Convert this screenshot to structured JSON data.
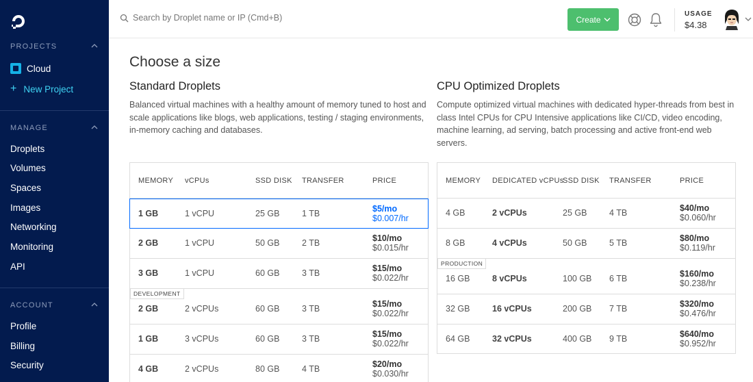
{
  "sidebar": {
    "projects_header": "PROJECTS",
    "projects": [
      {
        "label": "Cloud"
      },
      {
        "label": "New Project"
      }
    ],
    "manage_header": "MANAGE",
    "manage_items": [
      {
        "label": "Droplets"
      },
      {
        "label": "Volumes"
      },
      {
        "label": "Spaces"
      },
      {
        "label": "Images"
      },
      {
        "label": "Networking"
      },
      {
        "label": "Monitoring"
      },
      {
        "label": "API"
      }
    ],
    "account_header": "ACCOUNT",
    "account_items": [
      {
        "label": "Profile"
      },
      {
        "label": "Billing"
      },
      {
        "label": "Security"
      }
    ]
  },
  "topbar": {
    "search_placeholder": "Search by Droplet name or IP (Cmd+B)",
    "create_label": "Create",
    "usage_label": "USAGE",
    "usage_value": "$4.38"
  },
  "main": {
    "title": "Choose a size",
    "standard": {
      "title": "Standard Droplets",
      "description": "Balanced virtual machines with a healthy amount of memory tuned to host and scale applications like blogs, web applications, testing / staging environments, in-memory caching and databases.",
      "headers": [
        "MEMORY",
        "vCPUs",
        "SSD DISK",
        "TRANSFER",
        "PRICE"
      ],
      "rows": [
        {
          "memory": "1 GB",
          "vcpus": "1 vCPU",
          "disk": "25 GB",
          "transfer": "1 TB",
          "price_mo": "$5/mo",
          "price_hr": "$0.007/hr",
          "selected": true,
          "tag": ""
        },
        {
          "memory": "2 GB",
          "vcpus": "1 vCPU",
          "disk": "50 GB",
          "transfer": "2 TB",
          "price_mo": "$10/mo",
          "price_hr": "$0.015/hr",
          "tag": ""
        },
        {
          "memory": "3 GB",
          "vcpus": "1 vCPU",
          "disk": "60 GB",
          "transfer": "3 TB",
          "price_mo": "$15/mo",
          "price_hr": "$0.022/hr",
          "tag": ""
        },
        {
          "memory": "2 GB",
          "vcpus": "2 vCPUs",
          "disk": "60 GB",
          "transfer": "3 TB",
          "price_mo": "$15/mo",
          "price_hr": "$0.022/hr",
          "tag": "DEVELOPMENT"
        },
        {
          "memory": "1 GB",
          "vcpus": "3 vCPUs",
          "disk": "60 GB",
          "transfer": "3 TB",
          "price_mo": "$15/mo",
          "price_hr": "$0.022/hr",
          "tag": ""
        },
        {
          "memory": "4 GB",
          "vcpus": "2 vCPUs",
          "disk": "80 GB",
          "transfer": "4 TB",
          "price_mo": "$20/mo",
          "price_hr": "$0.030/hr",
          "tag": ""
        }
      ]
    },
    "cpu": {
      "title": "CPU Optimized Droplets",
      "description": "Compute optimized virtual machines with dedicated hyper-threads from best in class Intel CPUs for CPU Intensive applications like CI/CD, video encoding, machine learning, ad serving, batch processing and active front-end web servers.",
      "headers": [
        "MEMORY",
        "DEDICATED vCPUs",
        "SSD DISK",
        "TRANSFER",
        "PRICE"
      ],
      "rows": [
        {
          "memory": "4 GB",
          "vcpus": "2 vCPUs",
          "disk": "25 GB",
          "transfer": "4 TB",
          "price_mo": "$40/mo",
          "price_hr": "$0.060/hr",
          "tag": ""
        },
        {
          "memory": "8 GB",
          "vcpus": "4 vCPUs",
          "disk": "50 GB",
          "transfer": "5 TB",
          "price_mo": "$80/mo",
          "price_hr": "$0.119/hr",
          "tag": ""
        },
        {
          "memory": "16 GB",
          "vcpus": "8 vCPUs",
          "disk": "100 GB",
          "transfer": "6 TB",
          "price_mo": "$160/mo",
          "price_hr": "$0.238/hr",
          "tag": "PRODUCTION"
        },
        {
          "memory": "32 GB",
          "vcpus": "16 vCPUs",
          "disk": "200 GB",
          "transfer": "7 TB",
          "price_mo": "$320/mo",
          "price_hr": "$0.476/hr",
          "tag": ""
        },
        {
          "memory": "64 GB",
          "vcpus": "32 vCPUs",
          "disk": "400 GB",
          "transfer": "9 TB",
          "price_mo": "$640/mo",
          "price_hr": "$0.952/hr",
          "tag": ""
        }
      ]
    }
  }
}
